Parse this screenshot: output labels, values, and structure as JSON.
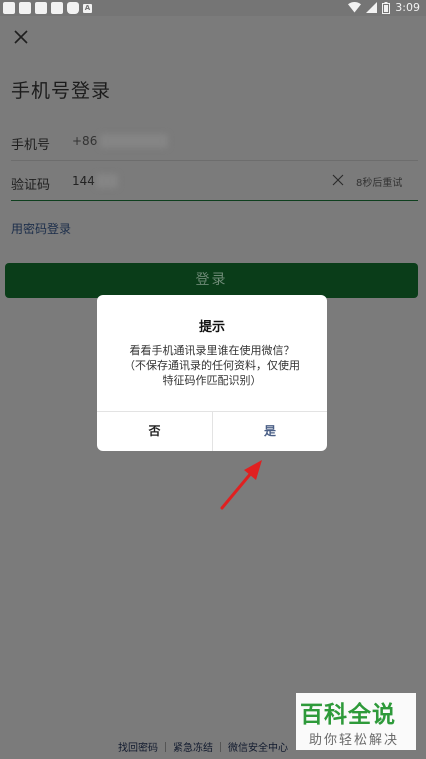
{
  "status_bar": {
    "time": "3:09",
    "icons": [
      "app-notification-icon",
      "app-notification-icon",
      "app-notification-icon",
      "square-icon",
      "round-icon",
      "mini-a-icon",
      "wifi-icon",
      "signal-icon",
      "battery-icon"
    ],
    "mini_icon_text": "A"
  },
  "page": {
    "title": "手机号登录",
    "phone_label": "手机号",
    "phone_prefix": "+86",
    "code_label": "验证码",
    "code_value": "144",
    "retry_label": "8秒后重试",
    "password_login_link": "用密码登录",
    "login_button": "登录"
  },
  "dialog": {
    "title": "提示",
    "message_line1": "看看手机通讯录里谁在使用微信？",
    "message_line2": "（不保存通讯录的任何资料，仅使用",
    "message_line3": "特征码作匹配识别）",
    "cancel_label": "否",
    "confirm_label": "是"
  },
  "footer": {
    "links": [
      "找回密码",
      "紧急冻结",
      "微信安全中心"
    ]
  },
  "watermark": {
    "main": "百科全说",
    "sub": "助你轻松解决"
  },
  "colors": {
    "overlay": "#7b7b7b",
    "login_button": "#0a3d19",
    "arrow": "#e02020",
    "confirm_text": "#4a5f86",
    "watermark_green": "#2e9a3a"
  }
}
